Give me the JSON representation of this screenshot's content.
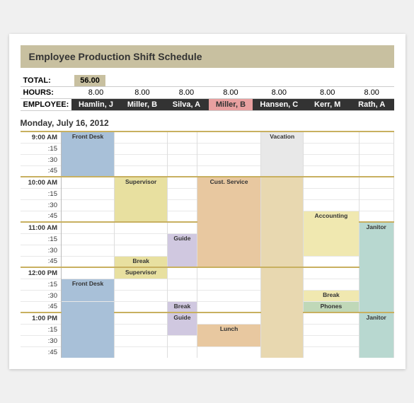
{
  "title": "Employee Production Shift Schedule",
  "summary": {
    "total_label": "TOTAL:",
    "total_value": "56.00",
    "hours_label": "HOURS:",
    "employee_label": "EMPLOYEE:"
  },
  "employees": [
    {
      "name": "Hamlin, J",
      "hours": "8.00",
      "highlight": false
    },
    {
      "name": "Miller, B",
      "hours": "8.00",
      "highlight": false
    },
    {
      "name": "Silva, A",
      "hours": "8.00",
      "highlight": false
    },
    {
      "name": "Miller, B",
      "hours": "8.00",
      "highlight": true
    },
    {
      "name": "Hansen, C",
      "hours": "8.00",
      "highlight": false
    },
    {
      "name": "Kerr, M",
      "hours": "8.00",
      "highlight": false
    },
    {
      "name": "Rath, A",
      "hours": "8.00",
      "highlight": false
    }
  ],
  "day": "Monday, July 16, 2012",
  "times": [
    "9:00 AM",
    ":30",
    ":45",
    "10:00 AM",
    ":15",
    ":30",
    ":45",
    "11:00 AM",
    ":15",
    ":30",
    ":45",
    "12:00 PM",
    ":15",
    ":30",
    ":45",
    "1:00 PM",
    ":15",
    ":30",
    ":45"
  ],
  "colors": {
    "blue": "#a8c0d8",
    "yellow": "#e8e0a0",
    "peach": "#e8c8a0",
    "pink": "#e8c0c0",
    "green": "#c0d8b8",
    "teal": "#b8d8d0",
    "purple": "#d0c8e0",
    "lt_yellow": "#f0e8b0",
    "header_bg": "#c8c0a0",
    "emp_bg": "#333333",
    "highlight_bg": "#e8a0a0"
  }
}
